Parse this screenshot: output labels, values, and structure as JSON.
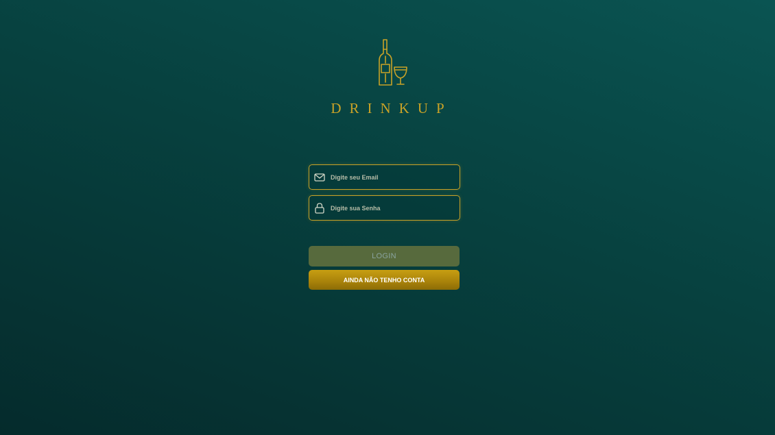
{
  "brand": {
    "name": "DRINKUP",
    "logo_icon": "wine-bottle-glass-icon",
    "color": "#c9a227"
  },
  "login_form": {
    "email": {
      "icon": "envelope-icon",
      "placeholder": "Digite seu Email",
      "value": ""
    },
    "password": {
      "icon": "lock-icon",
      "placeholder": "Digite sua Senha",
      "value": ""
    },
    "login_button": {
      "label": "LOGIN",
      "state": "disabled"
    },
    "signup_button": {
      "label": "AINDA NÃO TENHO CONTA"
    }
  },
  "colors": {
    "accent_gold": "#c9a227",
    "background_teal": "#07413f",
    "login_button_bg": "#576a3d"
  }
}
